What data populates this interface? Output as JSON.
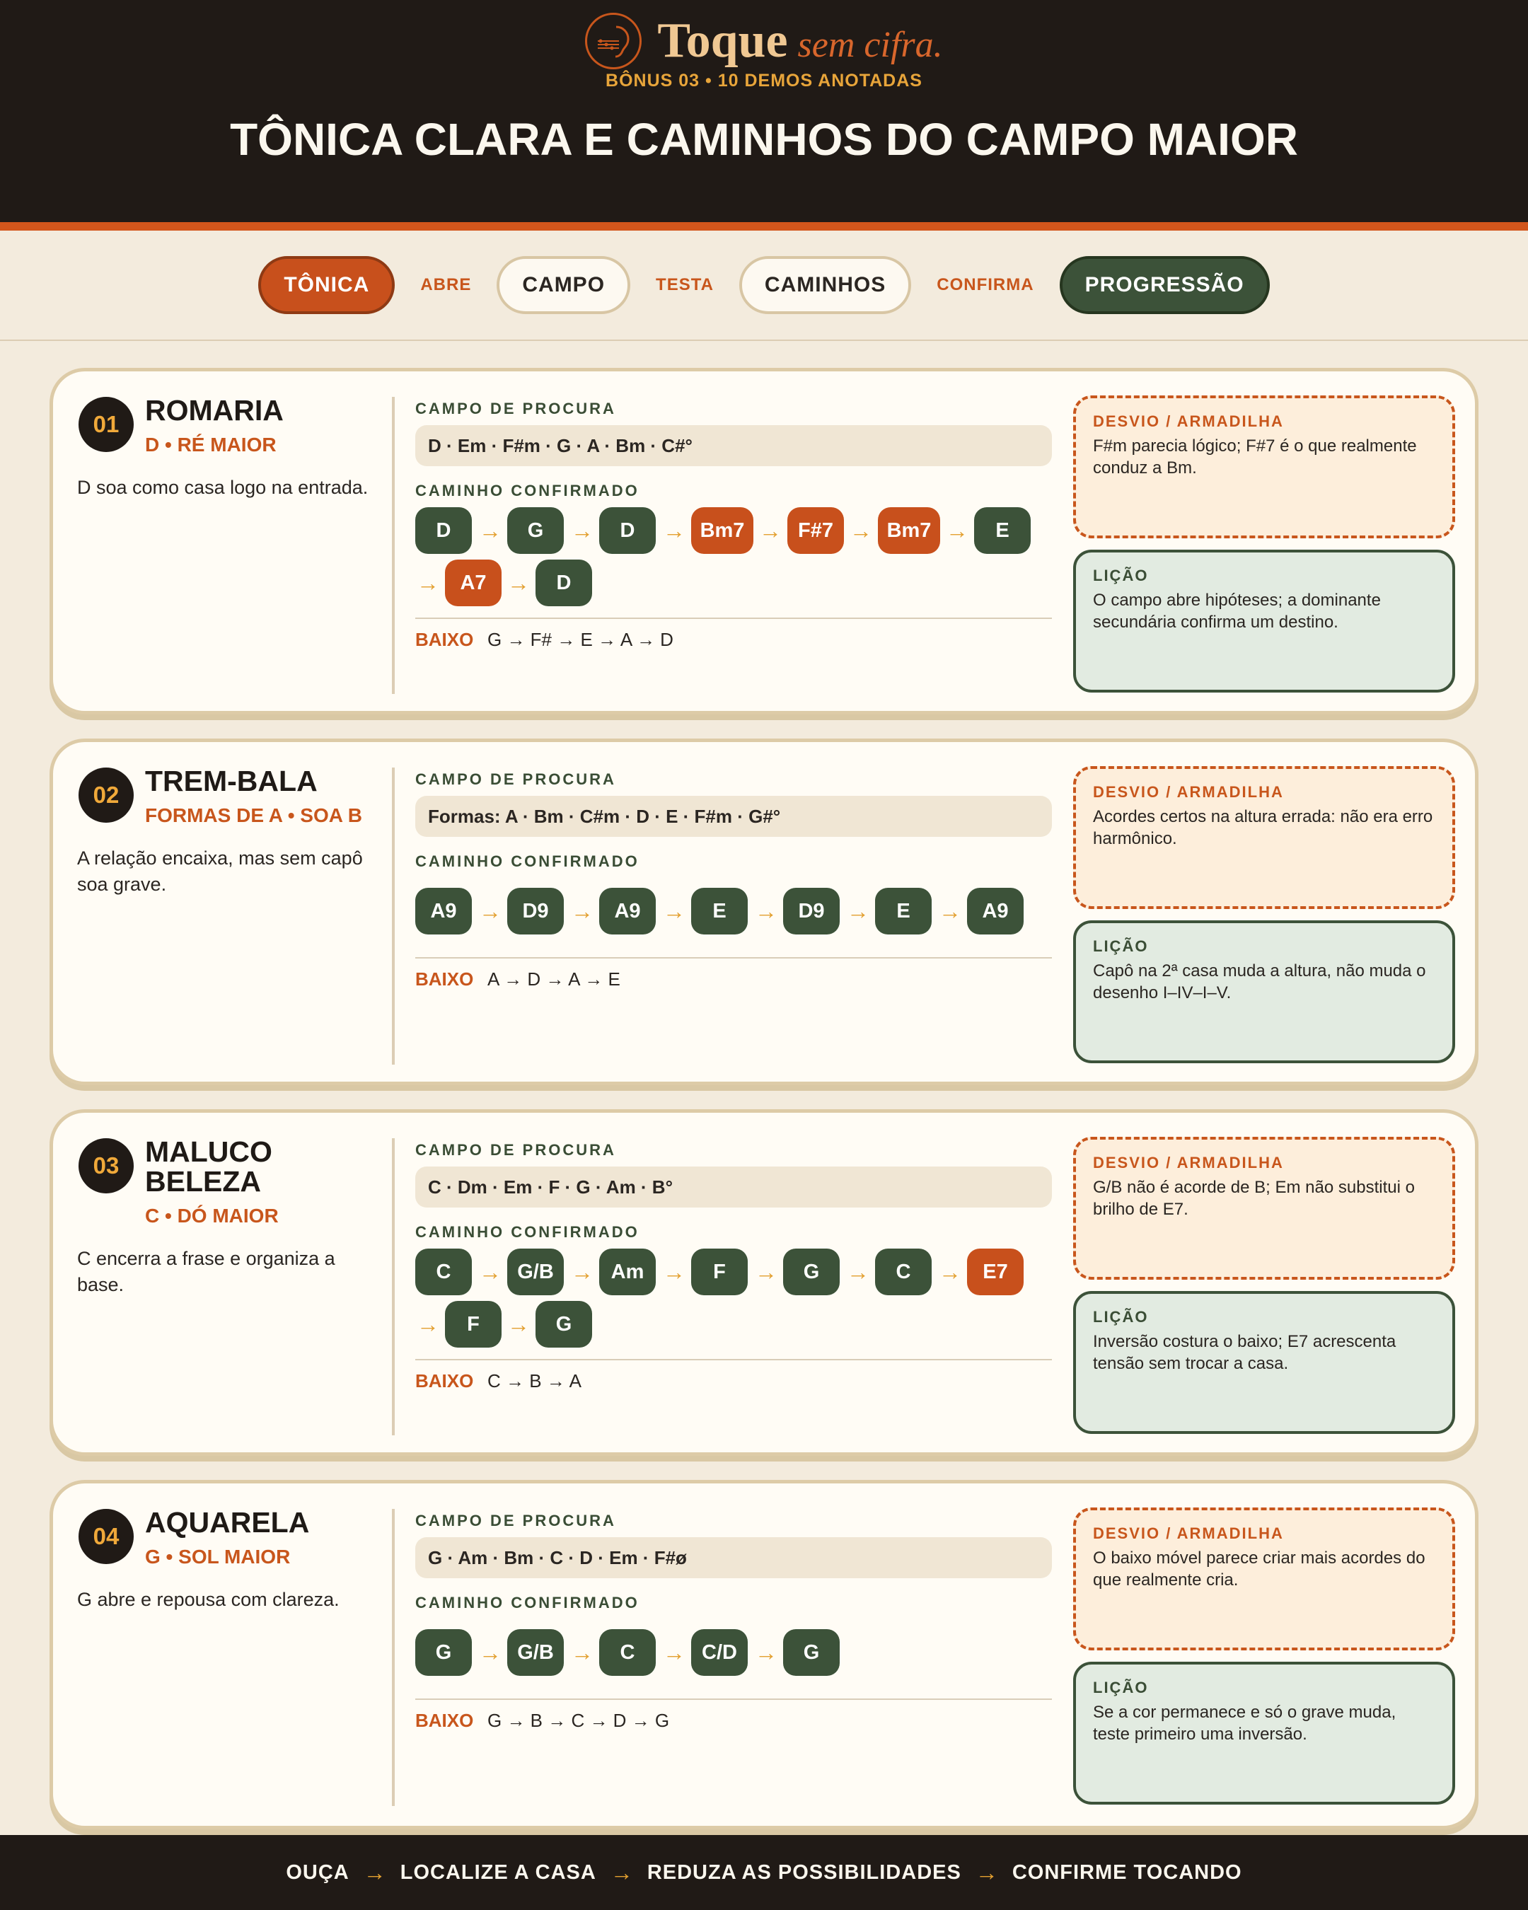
{
  "brand": {
    "name": "Toque",
    "tagline": "sem cifra."
  },
  "eyebrow": "BÔNUS 03 • 10 DEMOS ANOTADAS",
  "title": "TÔNICA CLARA E CAMINHOS DO CAMPO MAIOR",
  "flow": {
    "step1": "TÔNICA",
    "verb1": "ABRE",
    "step2": "CAMPO",
    "verb2": "TESTA",
    "step3": "CAMINHOS",
    "verb3": "CONFIRMA",
    "step4": "PROGRESSÃO"
  },
  "labels": {
    "campo": "CAMPO DE PROCURA",
    "caminho": "CAMINHO CONFIRMADO",
    "baixo": "BAIXO",
    "trap": "DESVIO / ARMADILHA",
    "lesson": "LIÇÃO",
    "arrow": "→"
  },
  "demos": [
    {
      "num": "01",
      "song": "ROMARIA",
      "key": "D • RÉ MAIOR",
      "desc": "D soa como casa logo na entrada.",
      "campo": "D · Em · F#m · G · A · Bm · C#°",
      "chords": [
        "D",
        "G",
        "D",
        "Bm7",
        "F#7",
        "Bm7",
        "E",
        "A7",
        "D"
      ],
      "baixo": "G → F# → E → A → D",
      "trap": "F#m parecia lógico; F#7 é o que realmente conduz a Bm.",
      "lesson": "O campo abre hipóteses; a dominante secundária confirma um destino."
    },
    {
      "num": "02",
      "song": "TREM-BALA",
      "key": "FORMAS DE A • SOA B",
      "desc": "A relação encaixa, mas sem capô soa grave.",
      "campo": "Formas: A · Bm · C#m · D · E · F#m · G#°",
      "chords": [
        "A9",
        "D9",
        "A9",
        "E",
        "D9",
        "E",
        "A9"
      ],
      "baixo": "A → D → A → E",
      "trap": "Acordes certos na altura errada: não era erro harmônico.",
      "lesson": "Capô na 2ª casa muda a altura, não muda o desenho I–IV–I–V."
    },
    {
      "num": "03",
      "song": "MALUCO BELEZA",
      "key": "C • DÓ MAIOR",
      "desc": "C encerra a frase e organiza a base.",
      "campo": "C · Dm · Em · F · G · Am · B°",
      "chords": [
        "C",
        "G/B",
        "Am",
        "F",
        "G",
        "C",
        "E7",
        "F",
        "G"
      ],
      "baixo": "C → B → A",
      "trap": "G/B não é acorde de B; Em não substitui o brilho de E7.",
      "lesson": "Inversão costura o baixo; E7 acrescenta tensão sem trocar a casa."
    },
    {
      "num": "04",
      "song": "AQUARELA",
      "key": "G • SOL MAIOR",
      "desc": "G abre e repousa com clareza.",
      "campo": "G · Am · Bm · C · D · Em · F#ø",
      "chords": [
        "G",
        "G/B",
        "C",
        "C/D",
        "G"
      ],
      "baixo": "G → B → C → D → G",
      "trap": "O baixo móvel parece criar mais acordes do que realmente cria.",
      "lesson": "Se a cor permanece e só o grave muda, teste primeiro uma inversão."
    }
  ],
  "footer": {
    "s1": "OUÇA",
    "s2": "LOCALIZE A CASA",
    "s3": "REDUZA AS POSSIBILIDADES",
    "s4": "CONFIRME TOCANDO"
  },
  "colors": {
    "accent": "#c8501c",
    "green": "#3c5239",
    "dark": "#201a16",
    "gold": "#e3a030",
    "cream": "#f3ebdd"
  },
  "icons": {
    "logo": "ear-with-strings-icon"
  }
}
